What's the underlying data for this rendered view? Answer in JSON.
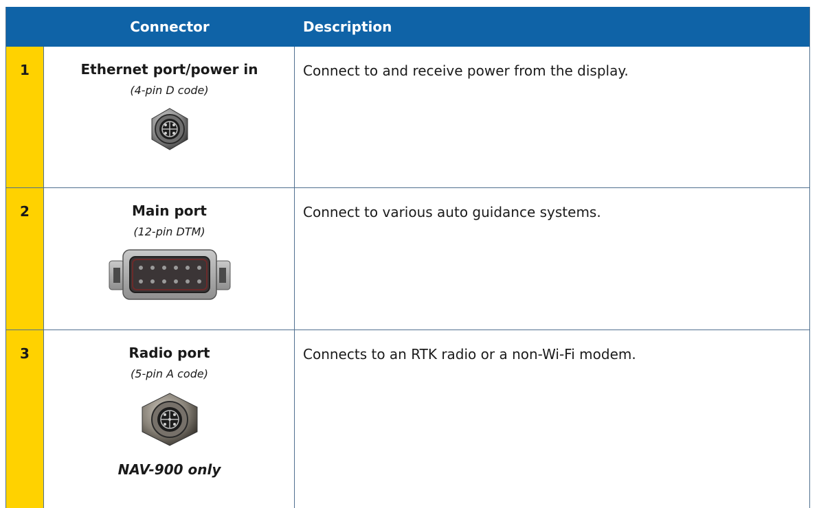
{
  "header": {
    "connector_label": "Connector",
    "description_label": "Description"
  },
  "colors": {
    "header_bg": "#0f63a7",
    "number_column_bg": "#ffd200",
    "border": "#4f6f8f"
  },
  "rows": [
    {
      "number": "1",
      "connector_name": "Ethernet port/power in",
      "connector_spec": "(4-pin D code)",
      "description": "Connect to and receive power from the display.",
      "image": "round-4-pin-connector"
    },
    {
      "number": "2",
      "connector_name": "Main port",
      "connector_spec": "(12-pin DTM)",
      "description": "Connect to various auto guidance systems.",
      "image": "rectangular-12-pin-connector"
    },
    {
      "number": "3",
      "connector_name": "Radio port",
      "connector_spec": "(5-pin A code)",
      "description": "Connects to an RTK radio or a non-Wi-Fi modem.",
      "note": "NAV-900 only",
      "image": "round-5-pin-connector"
    }
  ]
}
